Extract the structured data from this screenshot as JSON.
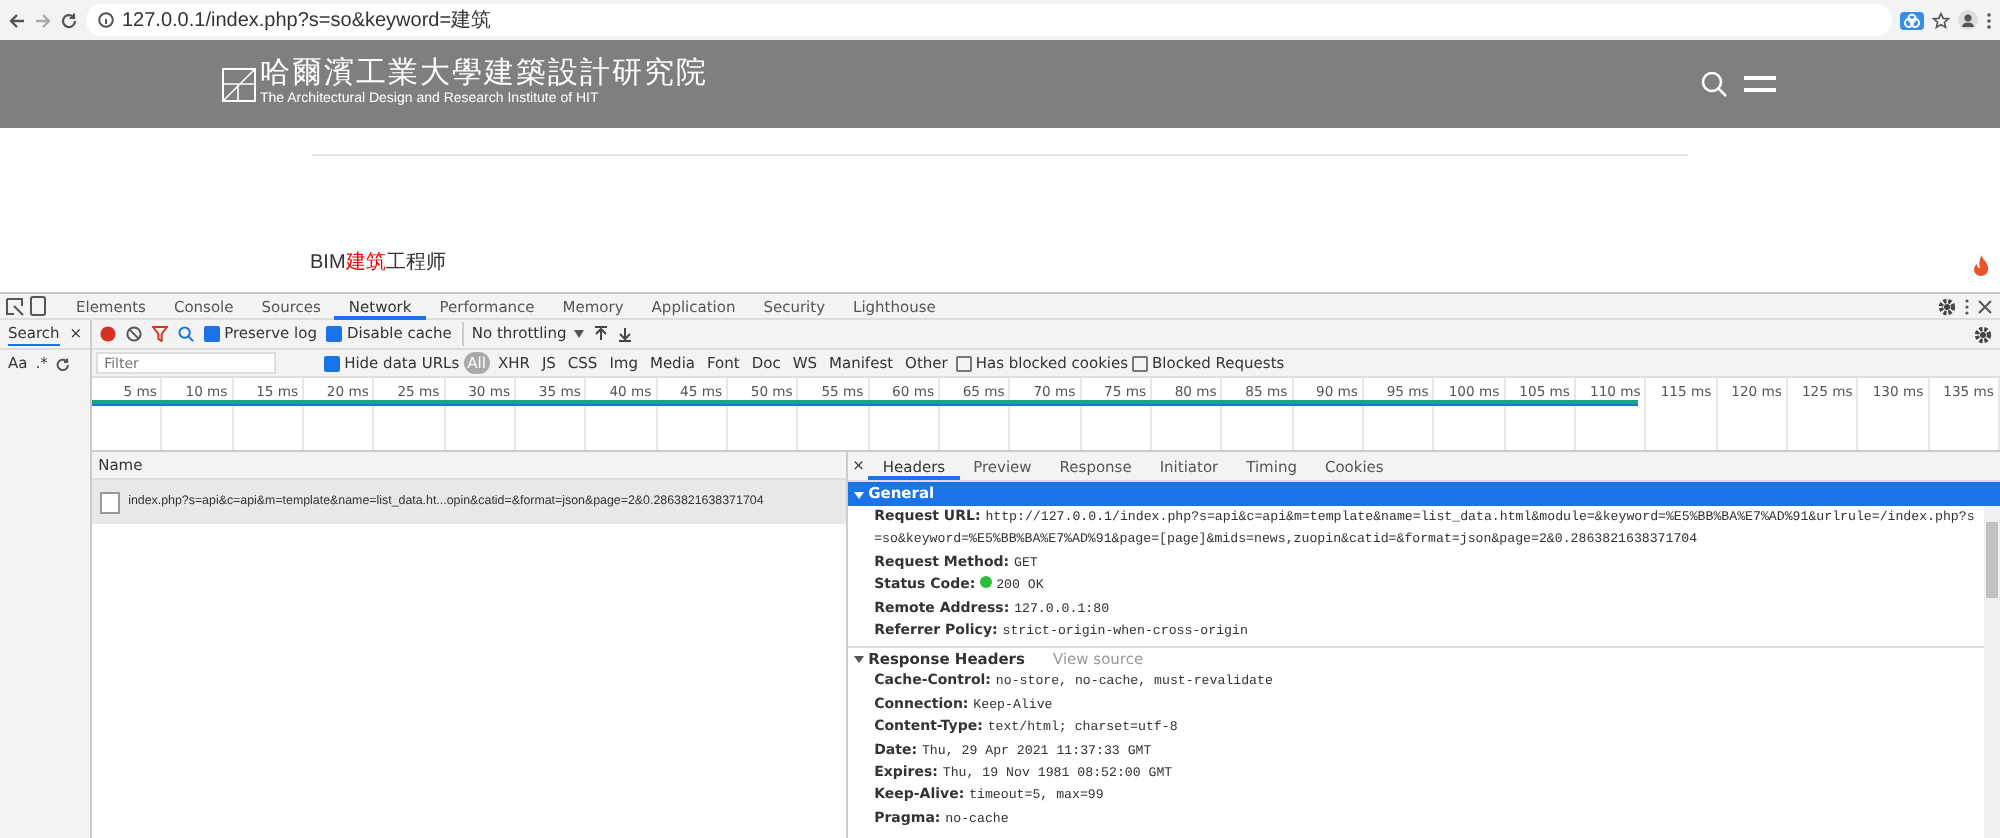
{
  "browser": {
    "url": "127.0.0.1/index.php?s=so&keyword=建筑"
  },
  "site": {
    "title": "哈爾濱工業大學建築設計研究院",
    "subtitle": "The Architectural Design and Research Institute of HIT",
    "result": "BIM**建筑**工程师"
  },
  "devtools": {
    "tabs": [
      {
        "label": "Elements",
        "selected": false
      },
      {
        "label": "Console",
        "selected": false
      },
      {
        "label": "Sources",
        "selected": false
      },
      {
        "label": "Network",
        "selected": true
      },
      {
        "label": "Performance",
        "selected": false
      },
      {
        "label": "Memory",
        "selected": false
      },
      {
        "label": "Application",
        "selected": false
      },
      {
        "label": "Security",
        "selected": false
      },
      {
        "label": "Lighthouse",
        "selected": false
      }
    ],
    "search_panel": {
      "label": "Search",
      "close": "×",
      "options": [
        "Aa",
        ".*"
      ]
    },
    "toolbar": {
      "recording": true,
      "preserve_log": {
        "label": "Preserve log",
        "checked": true
      },
      "disable_cache": {
        "label": "Disable cache",
        "checked": true
      },
      "throttling": "No throttling"
    },
    "filter": {
      "placeholder": "Filter",
      "hide_data_urls": {
        "label": "Hide data URLs",
        "checked": true
      },
      "types": [
        {
          "label": "All",
          "selected": true
        },
        {
          "label": "XHR",
          "selected": false
        },
        {
          "label": "JS",
          "selected": false
        },
        {
          "label": "CSS",
          "selected": false
        },
        {
          "label": "Img",
          "selected": false
        },
        {
          "label": "Media",
          "selected": false
        },
        {
          "label": "Font",
          "selected": false
        },
        {
          "label": "Doc",
          "selected": false
        },
        {
          "label": "WS",
          "selected": false
        },
        {
          "label": "Manifest",
          "selected": false
        },
        {
          "label": "Other",
          "selected": false
        }
      ],
      "options": [
        {
          "label": "Has blocked cookies",
          "checked": false
        },
        {
          "label": "Blocked Requests",
          "checked": false
        }
      ]
    },
    "timeline": {
      "ticks": [
        "5 ms",
        "10 ms",
        "15 ms",
        "20 ms",
        "25 ms",
        "30 ms",
        "35 ms",
        "40 ms",
        "45 ms",
        "50 ms",
        "55 ms",
        "60 ms",
        "65 ms",
        "70 ms",
        "75 ms",
        "80 ms",
        "85 ms",
        "90 ms",
        "95 ms",
        "100 ms",
        "105 ms",
        "110 ms",
        "115 ms",
        "120 ms",
        "125 ms",
        "130 ms",
        "135 ms"
      ],
      "level": 0.81
    },
    "requests": {
      "column": "Name",
      "rows": [
        {
          "name": "index.php?s=api&c=api&m=template&name=list_data.ht...opin&catid=&format=json&page=2&0.2863821638371704",
          "selected": true
        }
      ]
    },
    "details": {
      "close": "×",
      "tabs": [
        {
          "label": "Headers",
          "selected": true
        },
        {
          "label": "Preview",
          "selected": false
        },
        {
          "label": "Response",
          "selected": false
        },
        {
          "label": "Initiator",
          "selected": false
        },
        {
          "label": "Timing",
          "selected": false
        },
        {
          "label": "Cookies",
          "selected": false
        }
      ],
      "sections": [
        {
          "title": "General",
          "expanded": true,
          "selected": true,
          "rows": [
            {
              "key": "Request URL:",
              "value": "http://127.0.0.1/index.php?s=api&c=api&m=template&name=list_data.html&module=&keyword=%E5%BB%BA%E7%AD%91&urlrule=/index.php?s=so&keyword=%E5%BB%BA%E7%AD%91&page=[page]&mids=news,zuopin&catid=&format=json&page=2&0.2863821638371704"
            },
            {
              "key": "Request Method:",
              "value": "GET"
            },
            {
              "key": "Status Code:",
              "value": "200 OK",
              "color": "#2dbd3a"
            },
            {
              "key": "Remote Address:",
              "value": "127.0.0.1:80"
            },
            {
              "key": "Referrer Policy:",
              "value": "strict-origin-when-cross-origin"
            }
          ]
        },
        {
          "title": "Response Headers",
          "action": "View source",
          "expanded": true,
          "selected": false,
          "rows": [
            {
              "key": "Cache-Control:",
              "value": "no-store, no-cache, must-revalidate"
            },
            {
              "key": "Connection:",
              "value": "Keep-Alive"
            },
            {
              "key": "Content-Type:",
              "value": "text/html; charset=utf-8"
            },
            {
              "key": "Date:",
              "value": "Thu, 29 Apr 2021 11:37:33 GMT"
            },
            {
              "key": "Expires:",
              "value": "Thu, 19 Nov 1981 08:52:00 GMT"
            },
            {
              "key": "Keep-Alive:",
              "value": "timeout=5, max=99"
            },
            {
              "key": "Pragma:",
              "value": "no-cache"
            }
          ]
        }
      ]
    }
  }
}
